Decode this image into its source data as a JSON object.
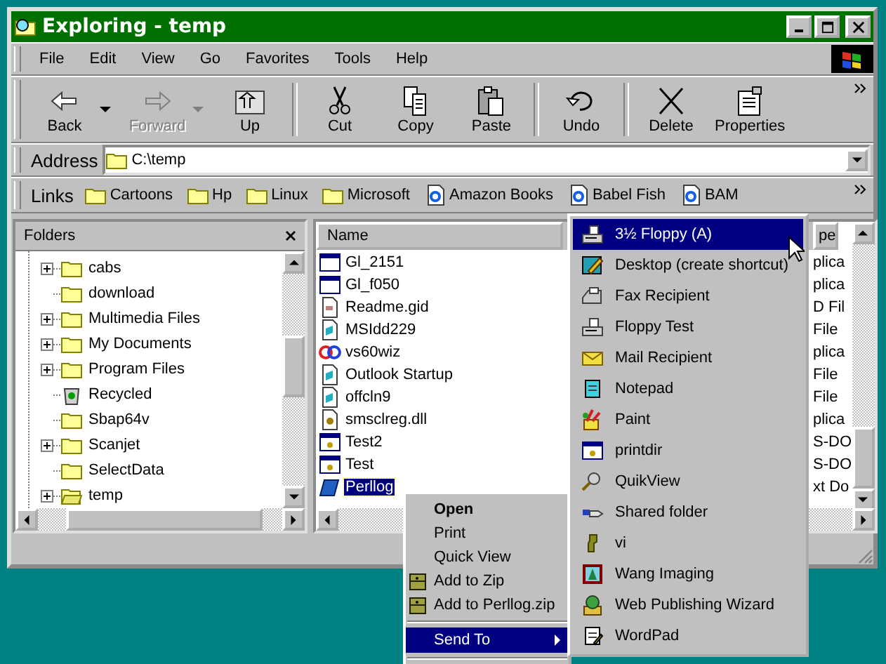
{
  "window": {
    "title": "Exploring - temp"
  },
  "menu": [
    {
      "label": "File"
    },
    {
      "label": "Edit"
    },
    {
      "label": "View"
    },
    {
      "label": "Go"
    },
    {
      "label": "Favorites"
    },
    {
      "label": "Tools"
    },
    {
      "label": "Help"
    }
  ],
  "toolbar": [
    [
      {
        "label": "Back",
        "kind": "back",
        "dropdown": true,
        "disabled": false
      },
      {
        "label": "Forward",
        "kind": "forward",
        "dropdown": true,
        "disabled": true
      },
      {
        "label": "Up",
        "kind": "up",
        "dropdown": false,
        "disabled": false
      }
    ],
    [
      {
        "label": "Cut",
        "kind": "cut",
        "dropdown": false,
        "disabled": false
      },
      {
        "label": "Copy",
        "kind": "copy",
        "dropdown": false,
        "disabled": false
      },
      {
        "label": "Paste",
        "kind": "paste",
        "dropdown": false,
        "disabled": false
      }
    ],
    [
      {
        "label": "Undo",
        "kind": "undo",
        "dropdown": false,
        "disabled": false
      }
    ],
    [
      {
        "label": "Delete",
        "kind": "delete",
        "dropdown": false,
        "disabled": false
      },
      {
        "label": "Properties",
        "kind": "properties",
        "dropdown": false,
        "disabled": false
      }
    ]
  ],
  "address": {
    "label": "Address",
    "value": "C:\\temp"
  },
  "links": {
    "label": "Links",
    "items": [
      {
        "label": "Cartoons",
        "kind": "folder"
      },
      {
        "label": "Hp",
        "kind": "folder"
      },
      {
        "label": "Linux",
        "kind": "folder"
      },
      {
        "label": "Microsoft",
        "kind": "folder"
      },
      {
        "label": "Amazon Books",
        "kind": "web"
      },
      {
        "label": "Babel Fish",
        "kind": "web"
      },
      {
        "label": "BAM",
        "kind": "web"
      }
    ]
  },
  "folders": {
    "title": "Folders",
    "items": [
      {
        "label": "cabs",
        "kind": "folder",
        "expandable": true
      },
      {
        "label": "download",
        "kind": "folder",
        "expandable": false
      },
      {
        "label": "Multimedia Files",
        "kind": "folder",
        "expandable": true
      },
      {
        "label": "My Documents",
        "kind": "folder",
        "expandable": true
      },
      {
        "label": "Program Files",
        "kind": "folder",
        "expandable": true
      },
      {
        "label": "Recycled",
        "kind": "recycle",
        "expandable": false
      },
      {
        "label": "Sbap64v",
        "kind": "folder",
        "expandable": false
      },
      {
        "label": "Scanjet",
        "kind": "folder",
        "expandable": true
      },
      {
        "label": "SelectData",
        "kind": "folder",
        "expandable": false
      },
      {
        "label": "temp",
        "kind": "openfolder",
        "expandable": true
      }
    ]
  },
  "files": {
    "columns": [
      "Name",
      "pe"
    ],
    "rows": [
      {
        "name": "Gl_2151",
        "type": "plica",
        "kind": "app",
        "selected": false
      },
      {
        "name": "Gl_f050",
        "type": "plica",
        "kind": "app",
        "selected": false
      },
      {
        "name": "Readme.gid",
        "type": "D Fil",
        "kind": "doc",
        "selected": false
      },
      {
        "name": "MSIdd229",
        "type": "File",
        "kind": "mapi",
        "selected": false
      },
      {
        "name": "vs60wiz",
        "type": "plica",
        "kind": "vs",
        "selected": false
      },
      {
        "name": "Outlook Startup",
        "type": "File",
        "kind": "mapi",
        "selected": false
      },
      {
        "name": "offcln9",
        "type": "File",
        "kind": "mapi",
        "selected": false
      },
      {
        "name": "smsclreg.dll",
        "type": "plica",
        "kind": "dll",
        "selected": false
      },
      {
        "name": "Test2",
        "type": "S-DO",
        "kind": "appgear",
        "selected": false
      },
      {
        "name": "Test",
        "type": "S-DO",
        "kind": "appgear",
        "selected": false
      },
      {
        "name": "Perllog",
        "type": "xt Do",
        "kind": "perl",
        "selected": true
      }
    ]
  },
  "context_menu": {
    "items": [
      {
        "kind": "item",
        "label": "Open",
        "default": true,
        "selected": false
      },
      {
        "kind": "item",
        "label": "Print",
        "default": false,
        "selected": false
      },
      {
        "kind": "item",
        "label": "Quick View",
        "default": false,
        "selected": false
      },
      {
        "kind": "zip",
        "label": "Add to Zip",
        "default": false,
        "selected": false
      },
      {
        "kind": "zip",
        "label": "Add to Perllog.zip",
        "default": false,
        "selected": false
      },
      {
        "kind": "separator"
      },
      {
        "kind": "submenu",
        "label": "Send To",
        "default": false,
        "selected": true
      },
      {
        "kind": "separator"
      }
    ]
  },
  "send_to": {
    "items": [
      {
        "label": "3½ Floppy (A)",
        "kind": "floppy",
        "selected": true
      },
      {
        "label": "Desktop (create shortcut)",
        "kind": "desktop",
        "selected": false
      },
      {
        "label": "Fax Recipient",
        "kind": "fax",
        "selected": false
      },
      {
        "label": "Floppy Test",
        "kind": "floppy",
        "selected": false
      },
      {
        "label": "Mail Recipient",
        "kind": "mail",
        "selected": false
      },
      {
        "label": "Notepad",
        "kind": "notepad",
        "selected": false
      },
      {
        "label": "Paint",
        "kind": "paint",
        "selected": false
      },
      {
        "label": "printdir",
        "kind": "appgear",
        "selected": false
      },
      {
        "label": "QuikView",
        "kind": "quikview",
        "selected": false
      },
      {
        "label": "Shared folder",
        "kind": "share",
        "selected": false
      },
      {
        "label": "vi",
        "kind": "vi",
        "selected": false
      },
      {
        "label": "Wang Imaging",
        "kind": "wang",
        "selected": false
      },
      {
        "label": "Web Publishing Wizard",
        "kind": "wizard",
        "selected": false
      },
      {
        "label": "WordPad",
        "kind": "wordpad",
        "selected": false
      }
    ]
  }
}
